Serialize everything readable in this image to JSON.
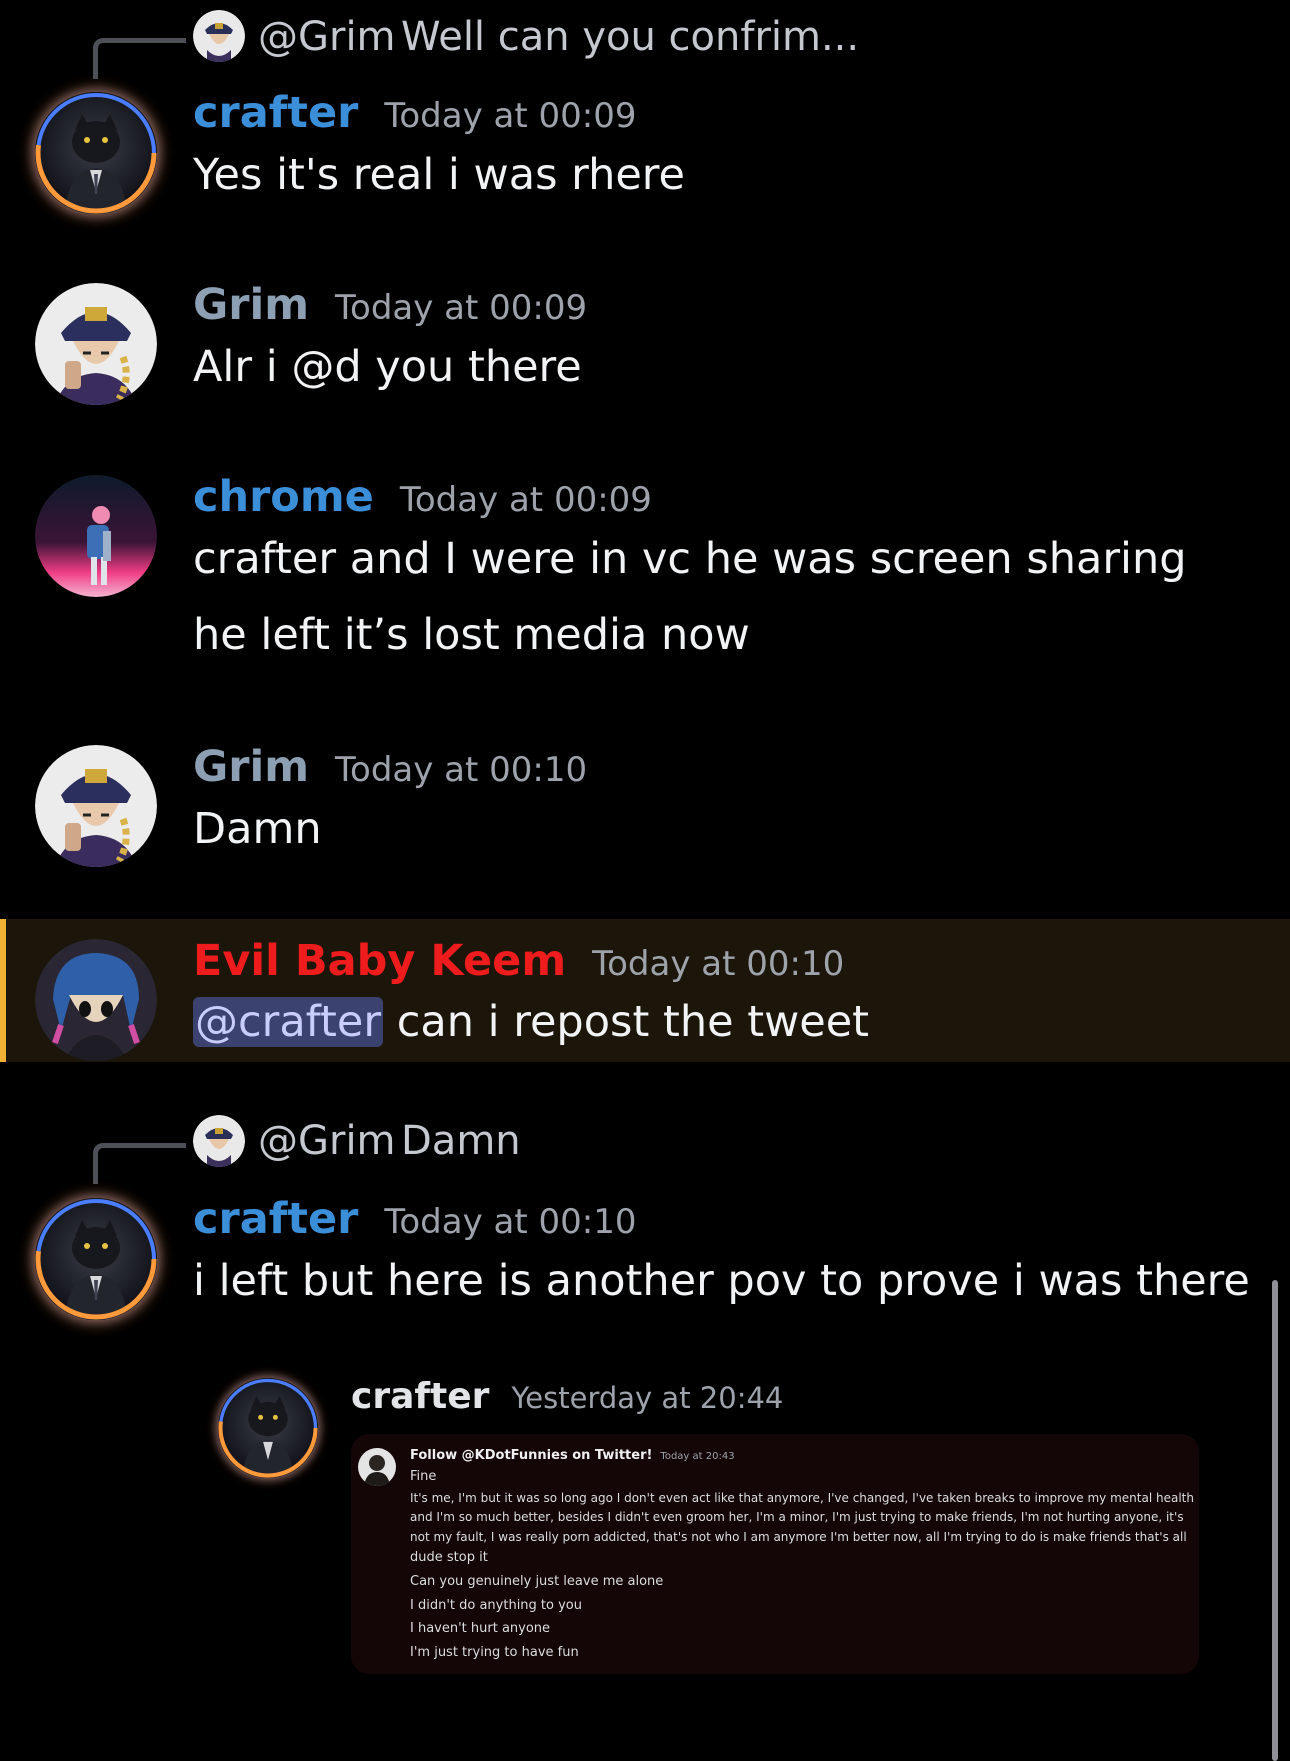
{
  "messages": {
    "m1": {
      "reply_user": "@Grim",
      "reply_text": "Well can you confrim...",
      "username": "crafter",
      "timestamp": "Today at 00:09",
      "text": "Yes it's real i was rhere"
    },
    "m2": {
      "username": "Grim",
      "timestamp": "Today at 00:09",
      "text": "Alr i @d you there"
    },
    "m3": {
      "username": "chrome",
      "timestamp": "Today at 00:09",
      "text_line1": "crafter and I were in vc he was screen sharing",
      "text_line2": "he left it’s lost media now"
    },
    "m4": {
      "username": "Grim",
      "timestamp": "Today at 00:10",
      "text": "Damn"
    },
    "m5": {
      "username": "Evil Baby Keem",
      "timestamp": "Today at 00:10",
      "mention": "@crafter",
      "text": "can i repost the tweet"
    },
    "m6": {
      "reply_user": "@Grim",
      "reply_text": "Damn",
      "username": "crafter",
      "timestamp": "Today at 00:10",
      "text": "i left but here is another pov to prove i was there"
    }
  },
  "attachment": {
    "username": "crafter",
    "timestamp": "Yesterday at 20:44",
    "embed": {
      "username": "Follow @KDotFunnies on Twitter!",
      "timestamp": "Today at 20:43",
      "lines": [
        "Fine",
        "It's me, I'm but it was so long ago I don't even act like that anymore, I've changed, I've taken breaks to improve my mental health",
        "and I'm so much better, besides I didn't even groom her, I'm a minor, I'm just trying to make friends, I'm not hurting anyone, it's",
        "not my fault, I was really porn addicted, that's not who I am anymore I'm better now, all I'm trying to do is make friends that's all",
        "dude stop it",
        "Can you genuinely just leave me alone",
        "I didn't do anything to you",
        "I haven't hurt anyone",
        "I'm just trying to have fun"
      ]
    }
  },
  "colors": {
    "crafter": "#3b8fd8",
    "grim": "#8d9fb3",
    "chrome": "#3b8fd8",
    "evil_baby_keem": "#ee1c1c",
    "highlight_bg": "#1b150a",
    "highlight_bar": "#f0b232"
  }
}
